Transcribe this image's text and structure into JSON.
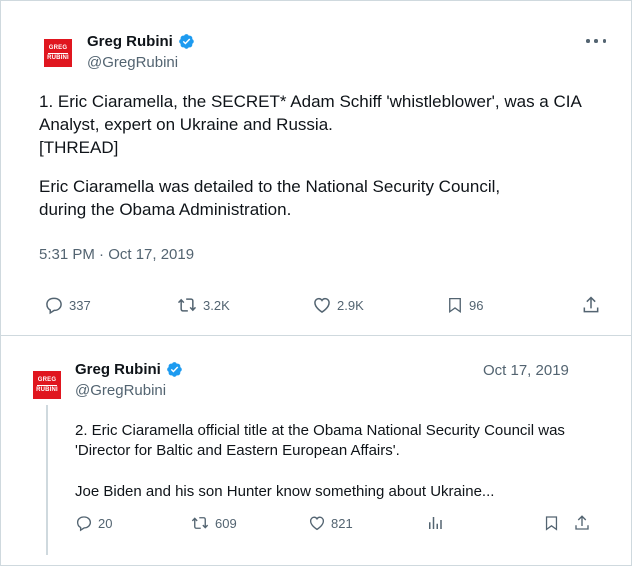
{
  "tweet": {
    "author": {
      "display_name": "Greg Rubini",
      "handle": "@GregRubini",
      "avatar_line1": "GREG",
      "avatar_line2": "RUBINI"
    },
    "more_icon": "more-dots-icon",
    "paragraph1": "1. Eric Ciaramella, the SECRET* Adam Schiff 'whistleblower', was a CIA",
    "paragraph1b": "Analyst, expert on Ukraine and Russia.",
    "paragraph1c": "[THREAD]",
    "paragraph2": "Eric Ciaramella was detailed to the National Security Council,",
    "paragraph2b": "during the Obama Administration.",
    "timestamp": "5:31 PM · Oct 17, 2019",
    "actions": {
      "replies": "337",
      "retweets": "3.2K",
      "likes": "2.9K",
      "bookmarks": "96"
    }
  },
  "reply": {
    "author": {
      "display_name": "Greg Rubini",
      "handle": "@GregRubini",
      "avatar_line1": "GREG",
      "avatar_line2": "RUBINI"
    },
    "date": "Oct 17, 2019",
    "line1": "2. Eric Ciaramella official title at the Obama National Security Council was",
    "line2": "'Director for Baltic and Eastern European Affairs'.",
    "line3": "Joe Biden and his son Hunter know something about Ukraine...",
    "actions": {
      "replies": "20",
      "retweets": "609",
      "likes": "821"
    }
  },
  "colors": {
    "verified": "#1d9bf0",
    "muted": "#536471",
    "text": "#0f1419",
    "avatar": "#e0161f"
  }
}
